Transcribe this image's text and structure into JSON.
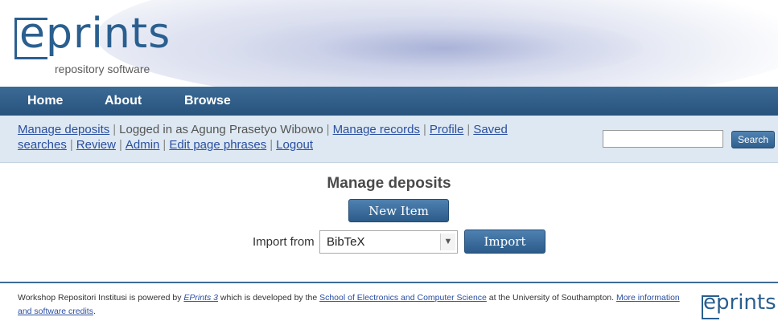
{
  "logo": {
    "text": "eprints",
    "tagline": "repository software"
  },
  "nav": [
    {
      "label": "Home"
    },
    {
      "label": "About"
    },
    {
      "label": "Browse"
    }
  ],
  "login_bar": {
    "manage_deposits": "Manage deposits",
    "logged_in_as": "Logged in as Agung Prasetyo Wibowo",
    "manage_records": "Manage records",
    "profile": "Profile",
    "saved_searches": "Saved searches",
    "review": "Review",
    "admin": "Admin",
    "edit_page_phrases": "Edit page phrases",
    "logout": "Logout"
  },
  "search": {
    "value": "",
    "button_label": "Search"
  },
  "main": {
    "title": "Manage deposits",
    "new_item_label": "New Item",
    "import_label": "Import from",
    "import_selected": "BibTeX",
    "import_button": "Import"
  },
  "footer": {
    "text_1": "Workshop Repositori Institusi is powered by ",
    "eprints_link": "EPrints 3",
    "text_2": " which is developed by the ",
    "school_link": "School of Electronics and Computer Science",
    "text_3": " at the University of Southampton. ",
    "more_info_link": "More information and software credits",
    "text_4": ".",
    "logo_text": "eprints"
  },
  "colors": {
    "nav": "#2f5d88",
    "link": "#2b4fa0",
    "loginbar": "#dde8f2"
  }
}
